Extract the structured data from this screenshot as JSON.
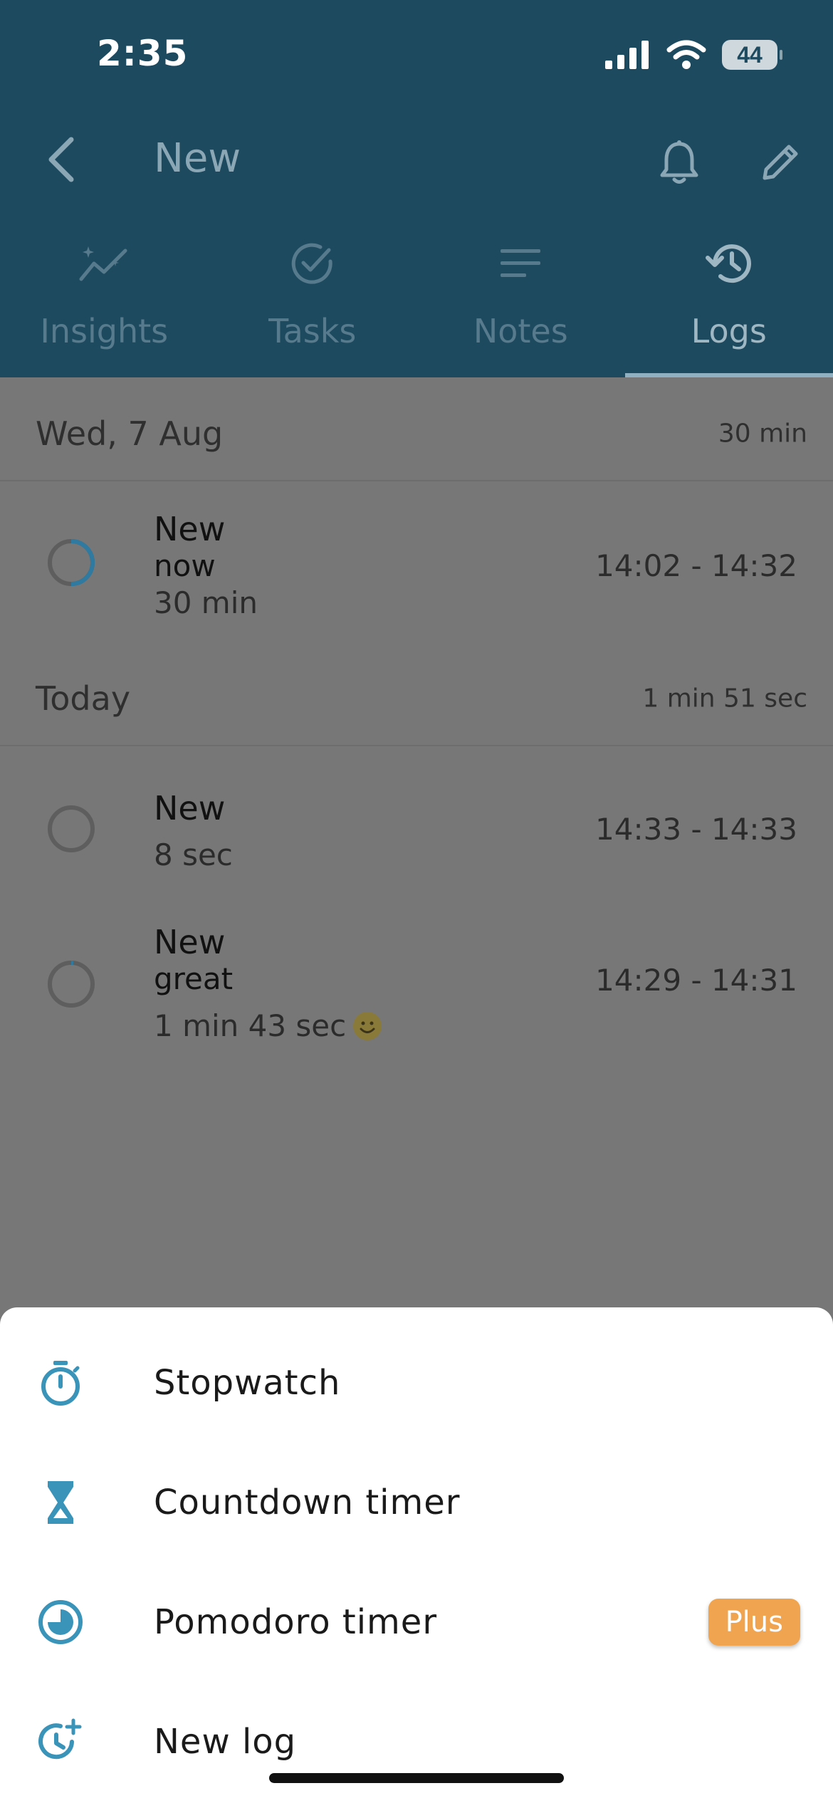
{
  "status_bar": {
    "time": "2:35",
    "battery": "44",
    "icons": [
      "signal-icon",
      "wifi-icon",
      "battery-icon"
    ]
  },
  "nav": {
    "title": "New",
    "icons": [
      "back-chevron-icon",
      "bell-icon",
      "pencil-icon"
    ]
  },
  "tabs": [
    {
      "label": "Insights",
      "icon": "insights-icon"
    },
    {
      "label": "Tasks",
      "icon": "check-circle-icon"
    },
    {
      "label": "Notes",
      "icon": "notes-icon"
    },
    {
      "label": "Logs",
      "icon": "history-icon",
      "active": true
    }
  ],
  "sections": [
    {
      "title": "Wed, 7 Aug",
      "total": "30 min",
      "logs": [
        {
          "title": "New",
          "note": "now",
          "duration": "30 min",
          "range": "14:02 - 14:32"
        }
      ]
    },
    {
      "title": "Today",
      "total": "1 min 51 sec",
      "logs": [
        {
          "title": "New",
          "duration": "8 sec",
          "range": "14:33 - 14:33"
        },
        {
          "title": "New",
          "note": "great",
          "duration": "1 min 43 sec",
          "range": "14:29 - 14:31",
          "emoji": "smile-emoji-icon"
        }
      ]
    }
  ],
  "sheet": {
    "items": [
      {
        "label": "Stopwatch",
        "icon": "stopwatch-icon"
      },
      {
        "label": "Countdown timer",
        "icon": "hourglass-icon"
      },
      {
        "label": "Pomodoro timer",
        "icon": "pomodoro-icon",
        "badge": "Plus"
      },
      {
        "label": "New log",
        "icon": "clock-plus-icon"
      }
    ]
  },
  "colors": {
    "header": "#1e4a60",
    "accent": "#3a93b8",
    "badge": "#f0a44f",
    "overlay": "#777777"
  }
}
